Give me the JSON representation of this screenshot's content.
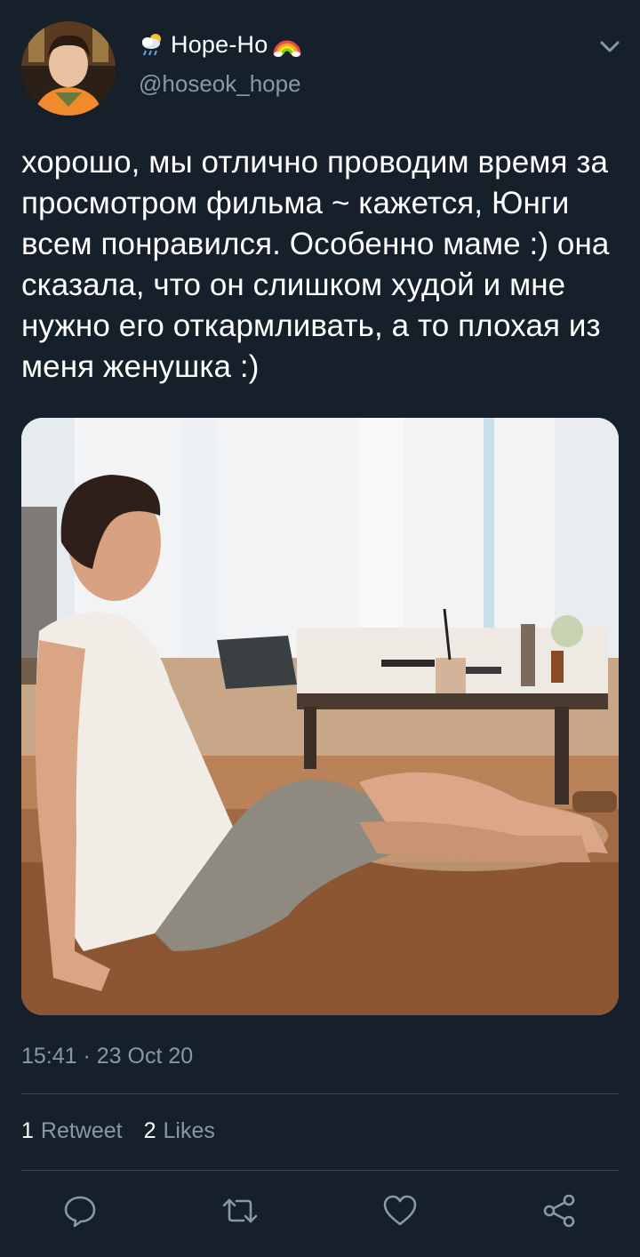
{
  "header": {
    "display_name": "Hope-Ho",
    "handle": "@hoseok_hope",
    "weather_icon": "cloud-rain-icon",
    "rainbow_icon": "rainbow-icon",
    "menu_icon": "chevron-down-icon"
  },
  "tweet": {
    "text": "хорошо, мы отлично проводим время за просмотром фильма ~ кажется, Юнги всем понравился. Особенно маме :) она сказала, что он слишком худой и мне нужно его откармливать, а то плохая из меня женушка :)",
    "timestamp": "15:41 · 23 Oct 20"
  },
  "stats": {
    "retweets_count": "1",
    "retweets_label": "Retweet",
    "likes_count": "2",
    "likes_label": "Likes"
  },
  "actions": [
    {
      "name": "reply",
      "icon": "reply-icon"
    },
    {
      "name": "retweet",
      "icon": "retweet-icon"
    },
    {
      "name": "like",
      "icon": "heart-icon"
    },
    {
      "name": "share",
      "icon": "share-icon"
    }
  ],
  "colors": {
    "background": "#15202b",
    "text_primary": "#ffffff",
    "text_secondary": "#8899a6",
    "divider": "#38444d"
  }
}
